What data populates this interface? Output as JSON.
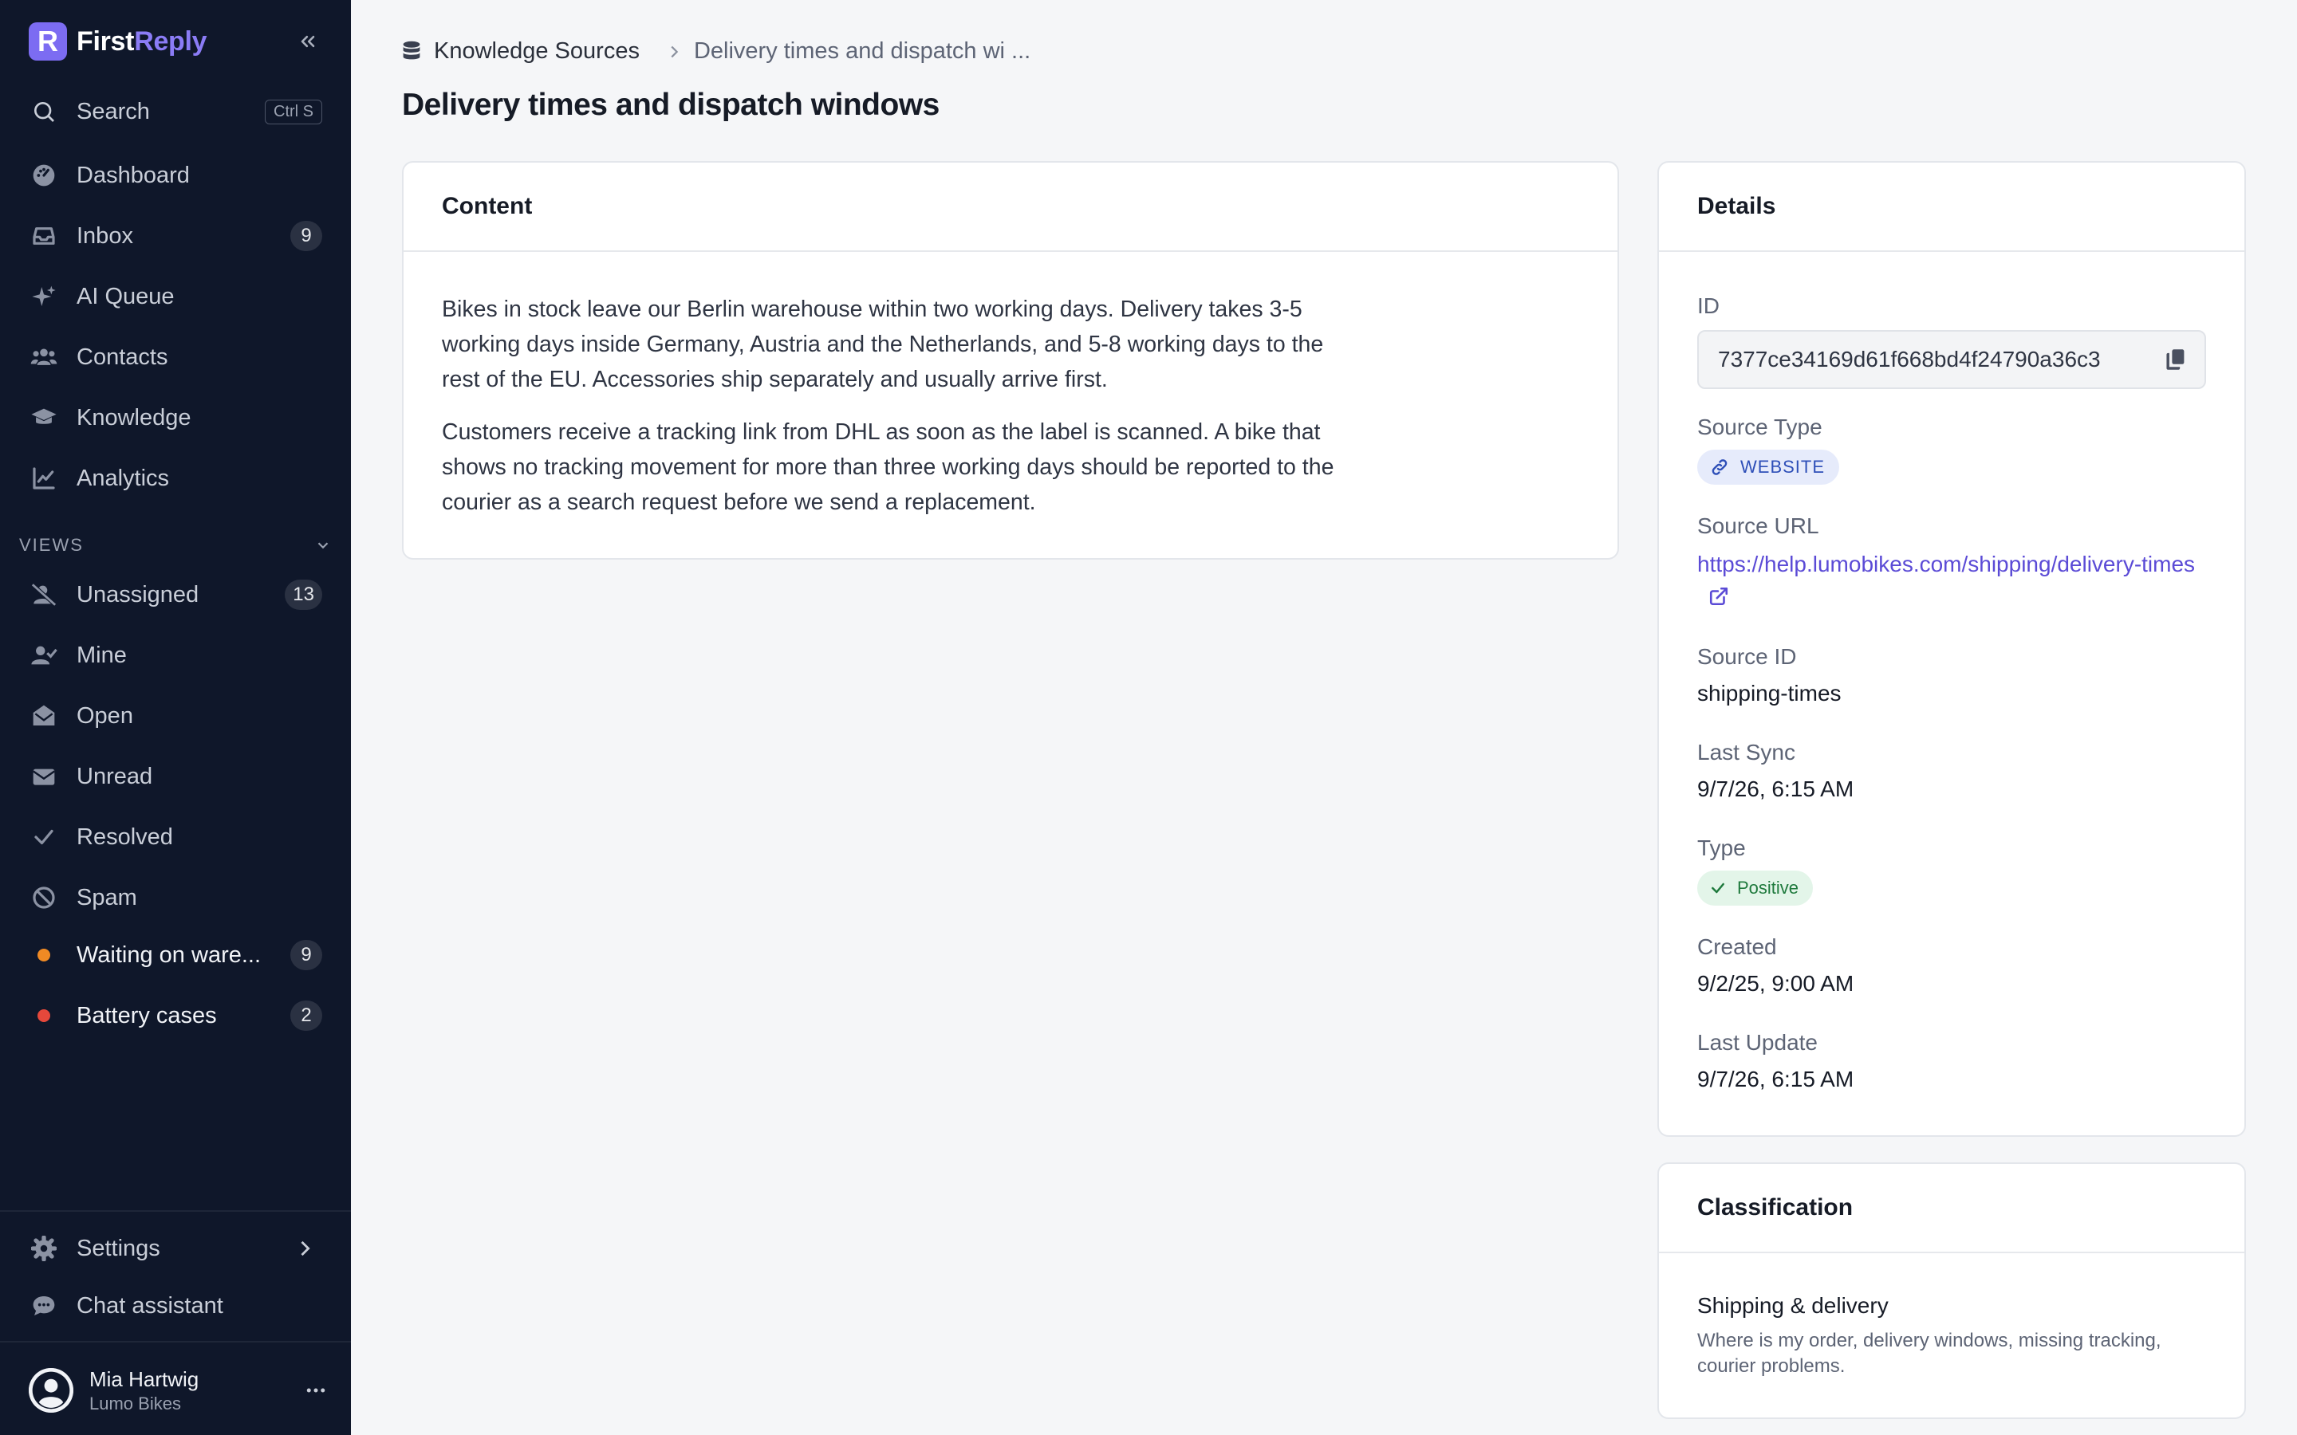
{
  "brand": {
    "logo_letter": "R",
    "name_part1": "First",
    "name_part2": "Reply",
    "accent_color": "#7c6cf2"
  },
  "sidebar": {
    "search": {
      "label": "Search",
      "shortcut": "Ctrl S"
    },
    "items": [
      {
        "label": "Dashboard",
        "icon": "dashboard-icon"
      },
      {
        "label": "Inbox",
        "icon": "inbox-icon",
        "count": "9"
      },
      {
        "label": "AI Queue",
        "icon": "sparkle-icon"
      },
      {
        "label": "Contacts",
        "icon": "users-icon"
      },
      {
        "label": "Knowledge",
        "icon": "graduation-cap-icon"
      },
      {
        "label": "Analytics",
        "icon": "chart-line-icon"
      }
    ],
    "views_header": "VIEWS",
    "views": [
      {
        "label": "Unassigned",
        "icon": "user-slash-icon",
        "count": "13"
      },
      {
        "label": "Mine",
        "icon": "user-check-icon"
      },
      {
        "label": "Open",
        "icon": "envelope-open-icon"
      },
      {
        "label": "Unread",
        "icon": "envelope-icon"
      },
      {
        "label": "Resolved",
        "icon": "check-icon"
      },
      {
        "label": "Spam",
        "icon": "ban-icon"
      },
      {
        "label": "Waiting on ware...",
        "dot_color": "#f08a24",
        "count": "9"
      },
      {
        "label": "Battery cases",
        "dot_color": "#e5483b",
        "count": "2"
      }
    ],
    "settings": {
      "label": "Settings",
      "icon": "gear-icon"
    },
    "chat": {
      "label": "Chat assistant",
      "icon": "chat-bubble-icon"
    },
    "user": {
      "name": "Mia Hartwig",
      "org": "Lumo Bikes"
    }
  },
  "breadcrumb": {
    "root": "Knowledge Sources",
    "current": "Delivery times and dispatch wi ..."
  },
  "page": {
    "title": "Delivery times and dispatch windows"
  },
  "content": {
    "header": "Content",
    "paragraphs": [
      "Bikes in stock leave our Berlin warehouse within two working days. Delivery takes 3-5 working days inside Germany, Austria and the Netherlands, and 5-8 working days to the rest of the EU. Accessories ship separately and usually arrive first.",
      "Customers receive a tracking link from DHL as soon as the label is scanned. A bike that shows no tracking movement for more than three working days should be reported to the courier as a search request before we send a replacement."
    ]
  },
  "details": {
    "header": "Details",
    "id_label": "ID",
    "id_value": "7377ce34169d61f668bd4f24790a36c3",
    "source_type_label": "Source Type",
    "source_type_value": "WEBSITE",
    "source_url_label": "Source URL",
    "source_url_value": "https://help.lumobikes.com/shipping/delivery-times",
    "source_id_label": "Source ID",
    "source_id_value": "shipping-times",
    "last_sync_label": "Last Sync",
    "last_sync_value": "9/7/26, 6:15 AM",
    "type_label": "Type",
    "type_value": "Positive",
    "created_label": "Created",
    "created_value": "9/2/25, 9:00 AM",
    "last_update_label": "Last Update",
    "last_update_value": "9/7/26, 6:15 AM"
  },
  "classification": {
    "header": "Classification",
    "title": "Shipping & delivery",
    "description": "Where is my order, delivery windows, missing tracking, courier problems."
  }
}
